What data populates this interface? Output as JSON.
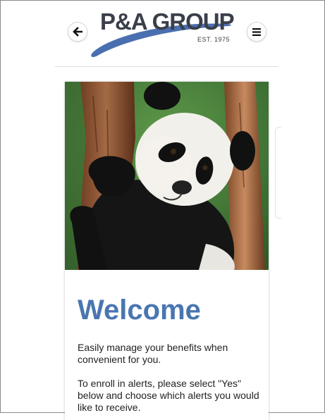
{
  "header": {
    "back_icon": "arrow-left-icon",
    "menu_icon": "hamburger-menu-icon",
    "logo": {
      "name": "P&A GROUP",
      "tagline": "EST. 1975",
      "swoosh_color": "#4a6fb0",
      "text_color": "#3a3f4a"
    }
  },
  "hero": {
    "image": "panda-in-tree-photo"
  },
  "content": {
    "title": "Welcome",
    "title_color": "#4a76b0",
    "paragraph1": "Easily manage your benefits when convenient for you.",
    "paragraph2": "To enroll in alerts, please select \"Yes\" below and choose which alerts you would like to receive."
  }
}
